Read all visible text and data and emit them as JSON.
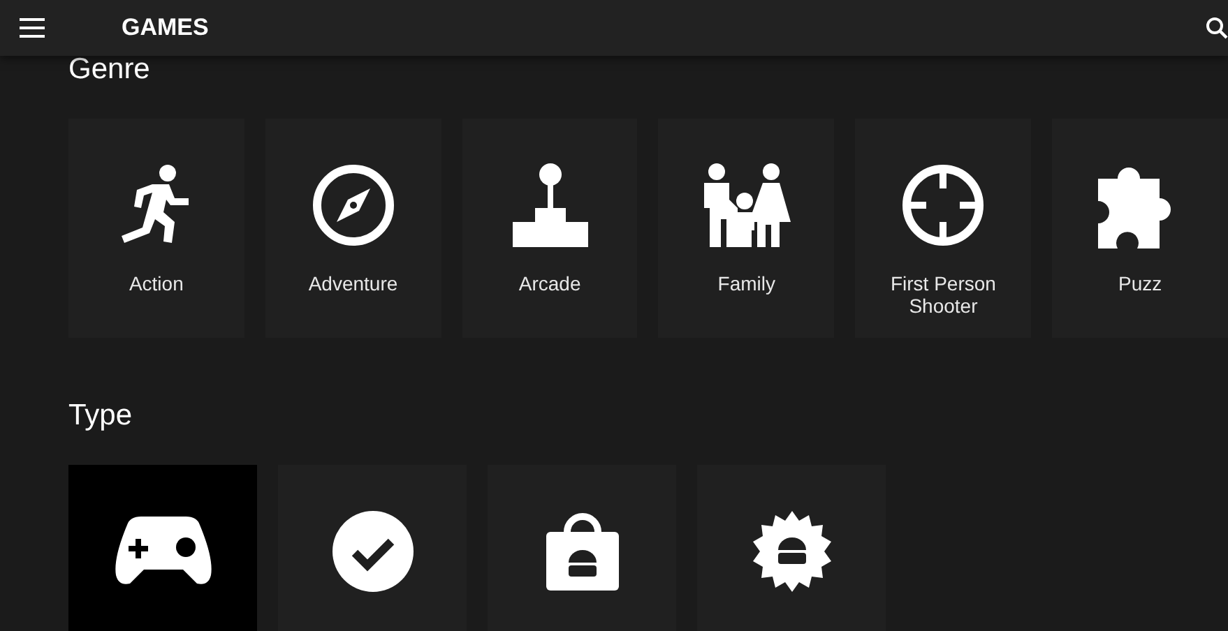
{
  "app_bar": {
    "title": "GAMES"
  },
  "sections": [
    {
      "heading": "Genre",
      "tiles": [
        {
          "kind": "runner",
          "label": "Action",
          "selected": false
        },
        {
          "kind": "compass",
          "label": "Adventure",
          "selected": false
        },
        {
          "kind": "joystick",
          "label": "Arcade",
          "selected": false
        },
        {
          "kind": "family",
          "label": "Family",
          "selected": false
        },
        {
          "kind": "crosshair",
          "label": "First Person Shooter",
          "selected": false
        },
        {
          "kind": "puzzle",
          "label": "Puzz",
          "selected": false
        }
      ]
    },
    {
      "heading": "Type",
      "tiles": [
        {
          "kind": "gamepad",
          "selected": true
        },
        {
          "kind": "check",
          "selected": false
        },
        {
          "kind": "bag",
          "selected": false
        },
        {
          "kind": "badge",
          "selected": false
        }
      ]
    }
  ]
}
